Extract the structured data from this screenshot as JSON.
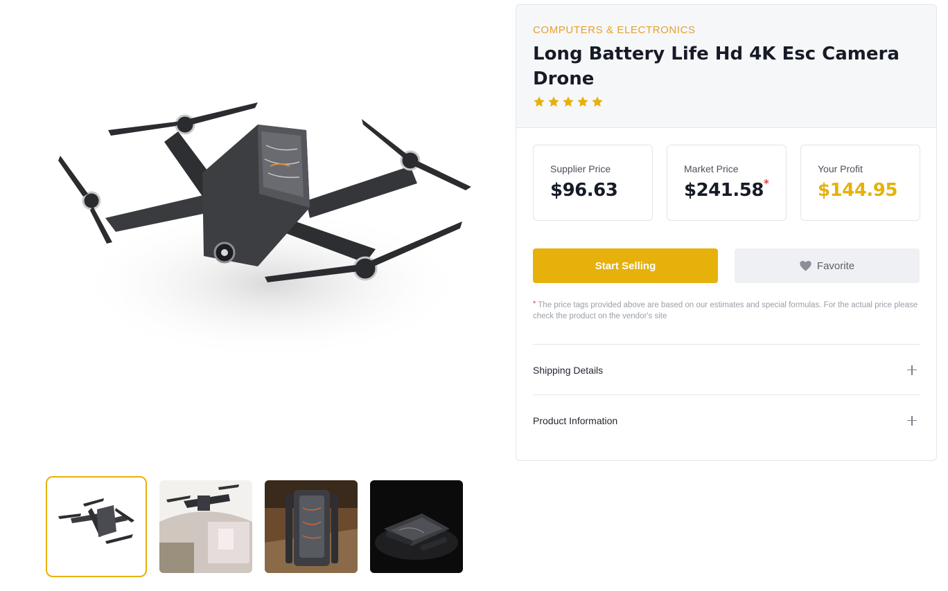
{
  "product": {
    "category": "COMPUTERS & ELECTRONICS",
    "title": "Long Battery Life Hd 4K Esc Camera Drone",
    "rating_stars": 5
  },
  "prices": {
    "supplier_label": "Supplier Price",
    "supplier_value": "$96.63",
    "market_label": "Market Price",
    "market_value": "$241.58",
    "market_marker": "*",
    "profit_label": "Your Profit",
    "profit_value": "$144.95"
  },
  "actions": {
    "start_selling": "Start Selling",
    "favorite": "Favorite"
  },
  "disclaimer": {
    "marker": "*",
    "text": "The price tags provided above are based on our estimates and special formulas. For the actual price please check the product on the vendor's site"
  },
  "accordion": [
    {
      "label": "Shipping Details"
    },
    {
      "label": "Product Information"
    }
  ],
  "gallery": {
    "thumbnails": [
      "drone-front-thumb",
      "drone-flying-room-thumb",
      "drone-folded-wood-thumb",
      "drone-folded-dark-thumb"
    ],
    "active_index": 0
  },
  "colors": {
    "accent": "#e6b10a",
    "category": "#e6a02a",
    "asterisk": "#e0413c"
  }
}
